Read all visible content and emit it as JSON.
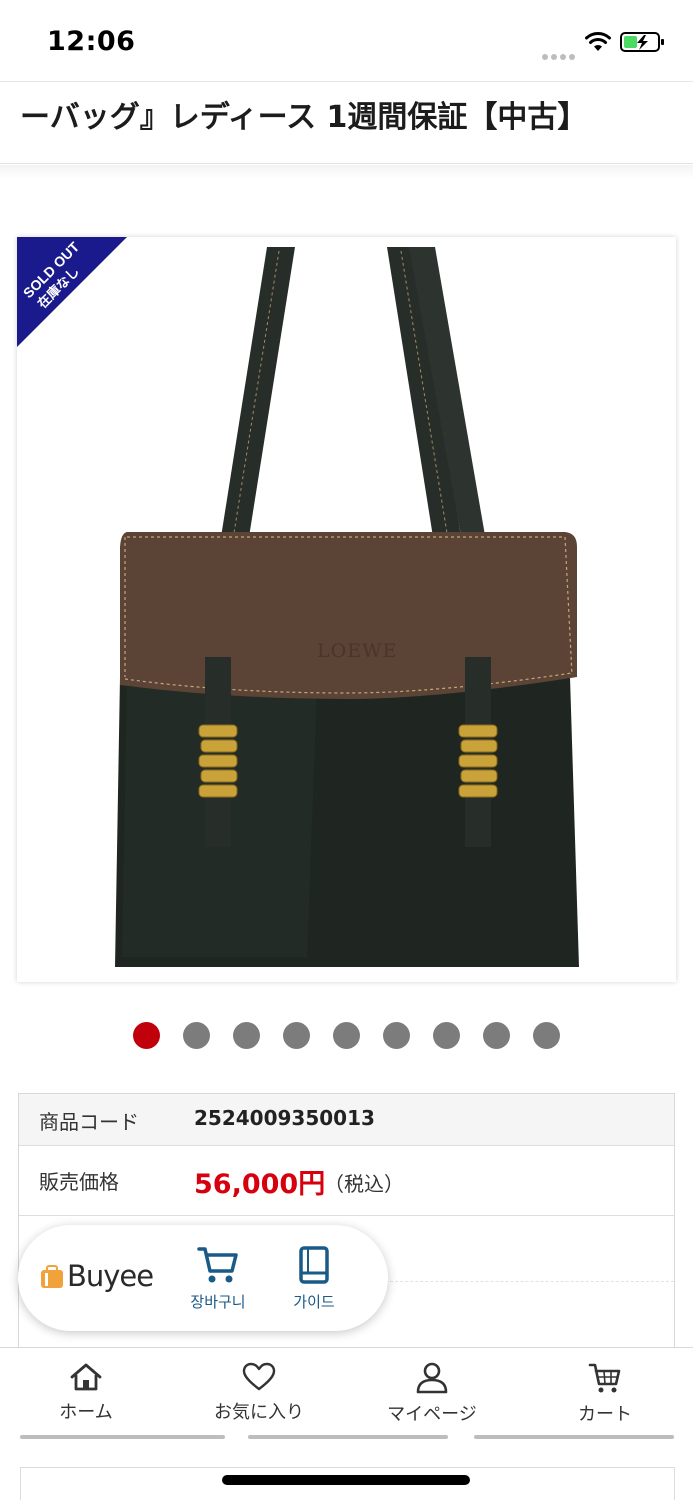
{
  "status_bar": {
    "time": "12:06"
  },
  "product": {
    "title": "ーバッグ』レディース 1週間保証【中古】",
    "badge": {
      "line1": "SOLD OUT",
      "line2": "在庫なし"
    },
    "image_brand_text": "LOEWE",
    "image_count": 9,
    "active_image_index": 0
  },
  "details": {
    "code_label": "商品コード",
    "code_value": "2524009350013",
    "price_label": "販売価格",
    "price_value": "56,000円",
    "tax_note": "（税込）"
  },
  "buyee": {
    "logo_text": "Buyee",
    "cart_label": "장바구니",
    "guide_label": "가이드"
  },
  "bottom_nav": {
    "home": "ホーム",
    "favorites": "お気に入り",
    "mypage": "マイページ",
    "cart": "カート"
  },
  "colors": {
    "price_red": "#d6000f",
    "active_dot": "#c0000b",
    "inactive_dot": "#7c7c7c",
    "badge_navy": "#1a1a8c",
    "buyee_blue": "#1a5a86",
    "buyee_orange": "#f2a23a"
  }
}
